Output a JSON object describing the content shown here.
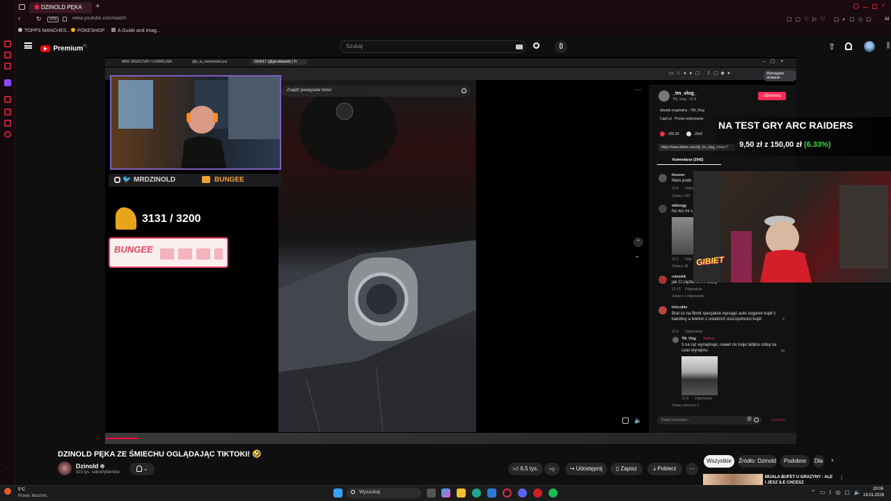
{
  "browser": {
    "active_tab": "DZINOLD PĘKA ZE ŚMI...",
    "url": "www.youtube.com/watch",
    "bookmarks": [
      "TOPPS MANCHES...",
      "POKESHOP",
      "A Guide and Imag..."
    ],
    "bookmark_ai": "AI"
  },
  "youtube": {
    "logo_text": "Premium",
    "logo_region": "PL",
    "search_placeholder": "Szukaj"
  },
  "stream": {
    "inner_tabs": [
      "MRD JASZCZUR I LUDWICZEK",
      "@p_to_mentioned you",
      "GINOLT (@ginoltdawid) | Ti"
    ],
    "inner_button": "Wymagane działanie",
    "tiktok_search": "Znajdź powiązane treści",
    "social_left": "MRDZINOLD",
    "social_right": "BUNGEE",
    "counter": "3131 / 3200",
    "bungee_brand": "BUNGEE",
    "arc_title": "NA TEST GRY ARC RAIDERS",
    "arc_price_from": "9,50 zł",
    "arc_price_sep": "z",
    "arc_price_to": "150,00 zł",
    "arc_percent": "(6.33%)",
    "gibiet": "GIBIET",
    "tiktok": {
      "username": "_tm_vlog_",
      "subline": "TM_Vlog · 12-5",
      "follow": "Obserwuj",
      "sound": "dźwięk oryginalny - TM_Vlog",
      "capcut": "CapCut · Proste edytowanie",
      "likes": "200.2K",
      "comments_count": "2542",
      "link": "https://www.tiktok.com/@_tm_vlog_/video/7",
      "comments_tab": "Komentarze (2542)",
      "comments": [
        {
          "user": "thenoirr",
          "text": "Mam podo",
          "date": "12-6",
          "reply": "Odpo",
          "more": "Zobacz 130"
        },
        {
          "user": "wiktorgg",
          "text": "No też mi s",
          "date": "12-6",
          "reply": "Odp",
          "more": "Zobacz 38"
        },
        {
          "user": "ruteeekk",
          "text": "jak Ci ciężko to mi oddaj",
          "date": "12-15",
          "reply": "Odpowiedz",
          "more": "Zobacz 1 odpowiedź"
        },
        {
          "user": "trixi.edits",
          "text": "Brat co na filmik specjalnie wynająć auto zegarek kupił z kakobvy a telefon z ostatnich oszczędności kupił",
          "date": "12-6",
          "reply": "Odpowiedz",
          "likes": "9"
        },
        {
          "user": "TM_Vlog",
          "badge": "Twórca",
          "text": "3 na raz wynajmuje, nawet mi moje tablice robią na czas wynajmu",
          "date": "12-6",
          "reply": "Odpowiedz",
          "likes": "80",
          "more": "Zobacz jeszcze 3"
        }
      ],
      "comment_placeholder": "Dodaj komentarz...",
      "post": "Opublikuj"
    }
  },
  "video": {
    "title": "DZINOLD PĘKA ZE ŚMIECHU OGLĄDAJĄC TIKTOKI! 🤣",
    "channel": "Dzinold",
    "subscribers": "323 tys. subskrybentów",
    "likes": "6,5 tys.",
    "share": "Udostępnij",
    "save": "Zapisz",
    "download": "Pobierz"
  },
  "sidebar_chips": [
    "Wszystkie",
    "Źródło: Dzinold",
    "Podobne",
    "Dla"
  ],
  "recommended": {
    "title": "MUALA BUFET U GRAŻYNY : ALE I JESZ ILE CHCESZ"
  },
  "taskbar": {
    "weather_temp": "5°C",
    "weather_desc": "Przew. bezchm.",
    "search": "Wyszukaj",
    "time": "20:06",
    "date": "19.01.2026"
  },
  "colors": {
    "accent_red": "#e0294a",
    "follow_red": "#fe2c55",
    "bungee_pink": "#e04760",
    "overlay_green": "#3ddc3d"
  }
}
